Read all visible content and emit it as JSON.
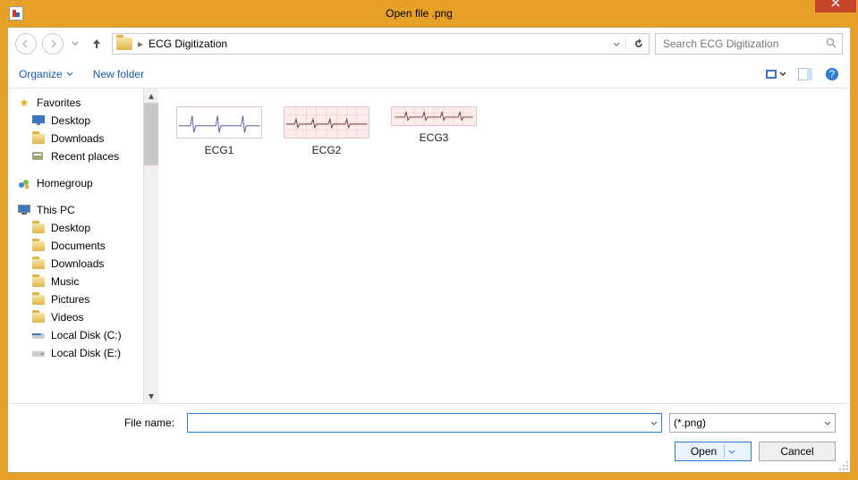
{
  "window": {
    "title": "Open file .png"
  },
  "nav": {
    "location": "ECG Digitization",
    "search_placeholder": "Search ECG Digitization"
  },
  "toolbar": {
    "organize": "Organize",
    "new_folder": "New folder"
  },
  "tree": {
    "favorites": {
      "label": "Favorites",
      "children": [
        {
          "icon": "desktop",
          "label": "Desktop"
        },
        {
          "icon": "downloads",
          "label": "Downloads"
        },
        {
          "icon": "recent",
          "label": "Recent places"
        }
      ]
    },
    "homegroup": {
      "label": "Homegroup"
    },
    "thispc": {
      "label": "This PC",
      "children": [
        {
          "icon": "desktop",
          "label": "Desktop"
        },
        {
          "icon": "documents",
          "label": "Documents"
        },
        {
          "icon": "downloads",
          "label": "Downloads"
        },
        {
          "icon": "music",
          "label": "Music"
        },
        {
          "icon": "pictures",
          "label": "Pictures"
        },
        {
          "icon": "videos",
          "label": "Videos"
        },
        {
          "icon": "drive",
          "label": "Local Disk (C:)"
        },
        {
          "icon": "drive",
          "label": "Local Disk (E:)"
        }
      ]
    }
  },
  "files": [
    {
      "name": "ECG1",
      "variant": "white"
    },
    {
      "name": "ECG2",
      "variant": "pink"
    },
    {
      "name": "ECG3",
      "variant": "pink"
    }
  ],
  "footer": {
    "filename_label": "File name:",
    "filename_value": "",
    "filter": "(*.png)",
    "open": "Open",
    "cancel": "Cancel"
  },
  "colors": {
    "accent": "#e8a128",
    "link": "#185abd",
    "primary_border": "#2f7dd1"
  }
}
